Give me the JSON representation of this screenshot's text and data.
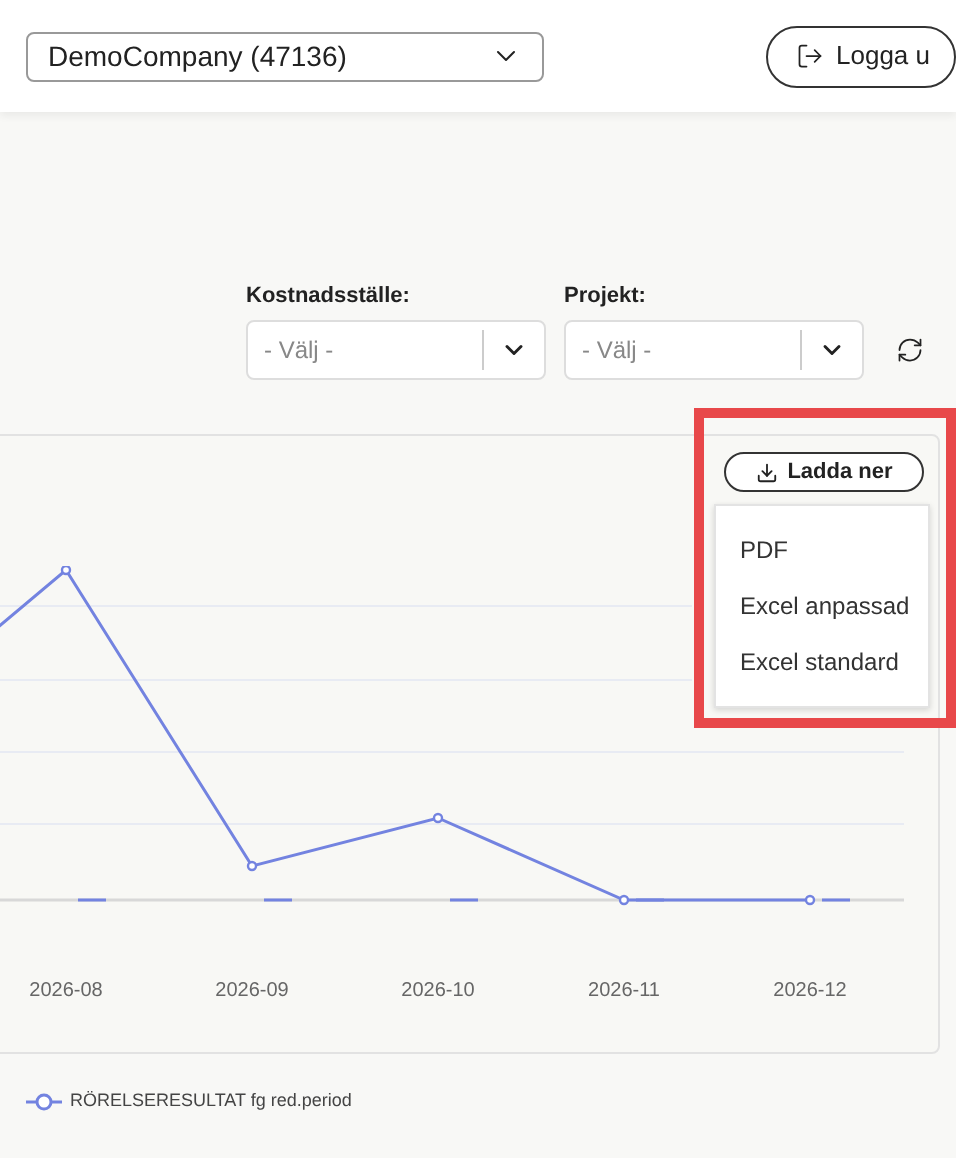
{
  "header": {
    "company_select": {
      "value": "DemoCompany (47136)"
    },
    "logout_button": {
      "label": "Logga u"
    }
  },
  "filters": [
    {
      "label": "Kostnadsställe:",
      "placeholder": "- Välj -"
    },
    {
      "label": "Projekt:",
      "placeholder": "- Välj -"
    }
  ],
  "download": {
    "label": "Ladda ner",
    "menu": [
      "PDF",
      "Excel anpassad",
      "Excel standard"
    ]
  },
  "chart": {
    "x_labels": [
      "2026-08",
      "2026-09",
      "2026-10",
      "2026-11",
      "2026-12"
    ],
    "legend": "RÖRELSERESULTAT fg red.period"
  }
}
